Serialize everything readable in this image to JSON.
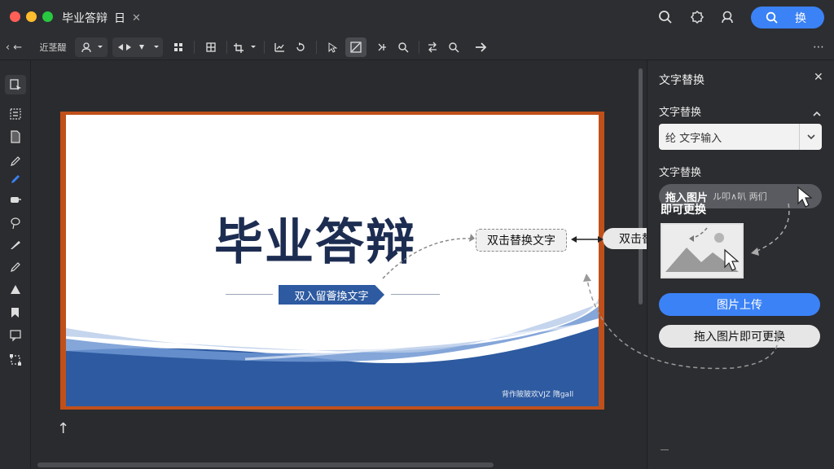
{
  "window": {
    "doc_title": "毕业答辩",
    "doc_tag": "日",
    "close_glyph": "✕"
  },
  "top_bar": {
    "action_label": "换"
  },
  "toolbar": {
    "zoom_text": "‹ ←",
    "mode_label": "近茎醍",
    "more_glyph": "⋯"
  },
  "slide": {
    "title": "毕业答辩",
    "subtitle": "双入留薈換文字",
    "footer": "背作陂陂欢VJZ 隋gall",
    "placeholder_box": "双击替换文字"
  },
  "callout": {
    "label": "双击替换文字"
  },
  "panel": {
    "title": "文字替换",
    "section1": "文字替换",
    "select_value": "纶 文字输入",
    "section2": "文字替换",
    "pill_bold": "拖入图片",
    "pill_small": "ル叩∧叭 两们",
    "pill_line2": "即可更换",
    "upload_button": "图片上传",
    "drag_button": "拖入图片即可更换"
  },
  "colors": {
    "accent": "#3b82f6",
    "slide_frame": "#c0501a",
    "slide_title": "#1d2d52",
    "slide_blue": "#2d5aa0"
  }
}
